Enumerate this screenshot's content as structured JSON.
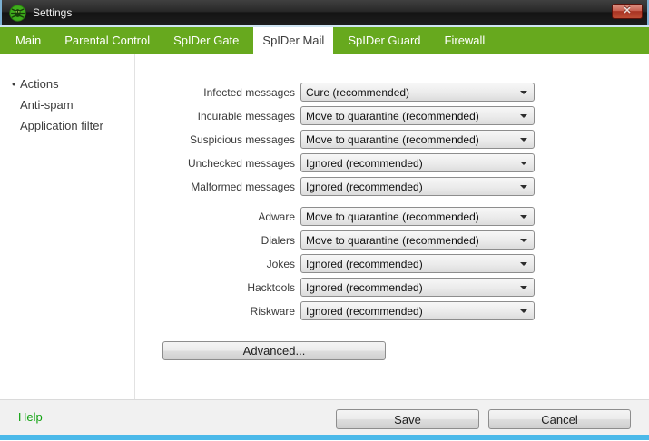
{
  "window": {
    "title": "Settings",
    "close_glyph": "✕"
  },
  "tabs": [
    {
      "label": "Main",
      "active": false
    },
    {
      "label": "Parental Control",
      "active": false
    },
    {
      "label": "SpIDer Gate",
      "active": false
    },
    {
      "label": "SpIDer Mail",
      "active": true
    },
    {
      "label": "SpIDer Guard",
      "active": false
    },
    {
      "label": "Firewall",
      "active": false
    }
  ],
  "sidebar": {
    "bullet_glyph": "•",
    "items": [
      {
        "label": "Actions",
        "selected": true
      },
      {
        "label": "Anti-spam",
        "selected": false
      },
      {
        "label": "Application filter",
        "selected": false
      }
    ]
  },
  "panel": {
    "groups": [
      {
        "rows": [
          {
            "label": "Infected messages",
            "value": "Cure (recommended)"
          },
          {
            "label": "Incurable messages",
            "value": "Move to quarantine (recommended)"
          },
          {
            "label": "Suspicious messages",
            "value": "Move to quarantine (recommended)"
          },
          {
            "label": "Unchecked messages",
            "value": "Ignored (recommended)"
          },
          {
            "label": "Malformed messages",
            "value": "Ignored (recommended)"
          }
        ]
      },
      {
        "rows": [
          {
            "label": "Adware",
            "value": "Move to quarantine (recommended)"
          },
          {
            "label": "Dialers",
            "value": "Move to quarantine (recommended)"
          },
          {
            "label": "Jokes",
            "value": "Ignored (recommended)"
          },
          {
            "label": "Hacktools",
            "value": "Ignored (recommended)"
          },
          {
            "label": "Riskware",
            "value": "Ignored (recommended)"
          }
        ]
      }
    ],
    "advanced_label": "Advanced..."
  },
  "footer": {
    "help_label": "Help",
    "save_label": "Save",
    "cancel_label": "Cancel"
  },
  "colors": {
    "brand_green": "#67a91e",
    "help_green": "#12a312",
    "bottom_strip_blue": "#4bb9e9",
    "titlebar_dark": "#1d1d1d",
    "close_red": "#a93423"
  }
}
